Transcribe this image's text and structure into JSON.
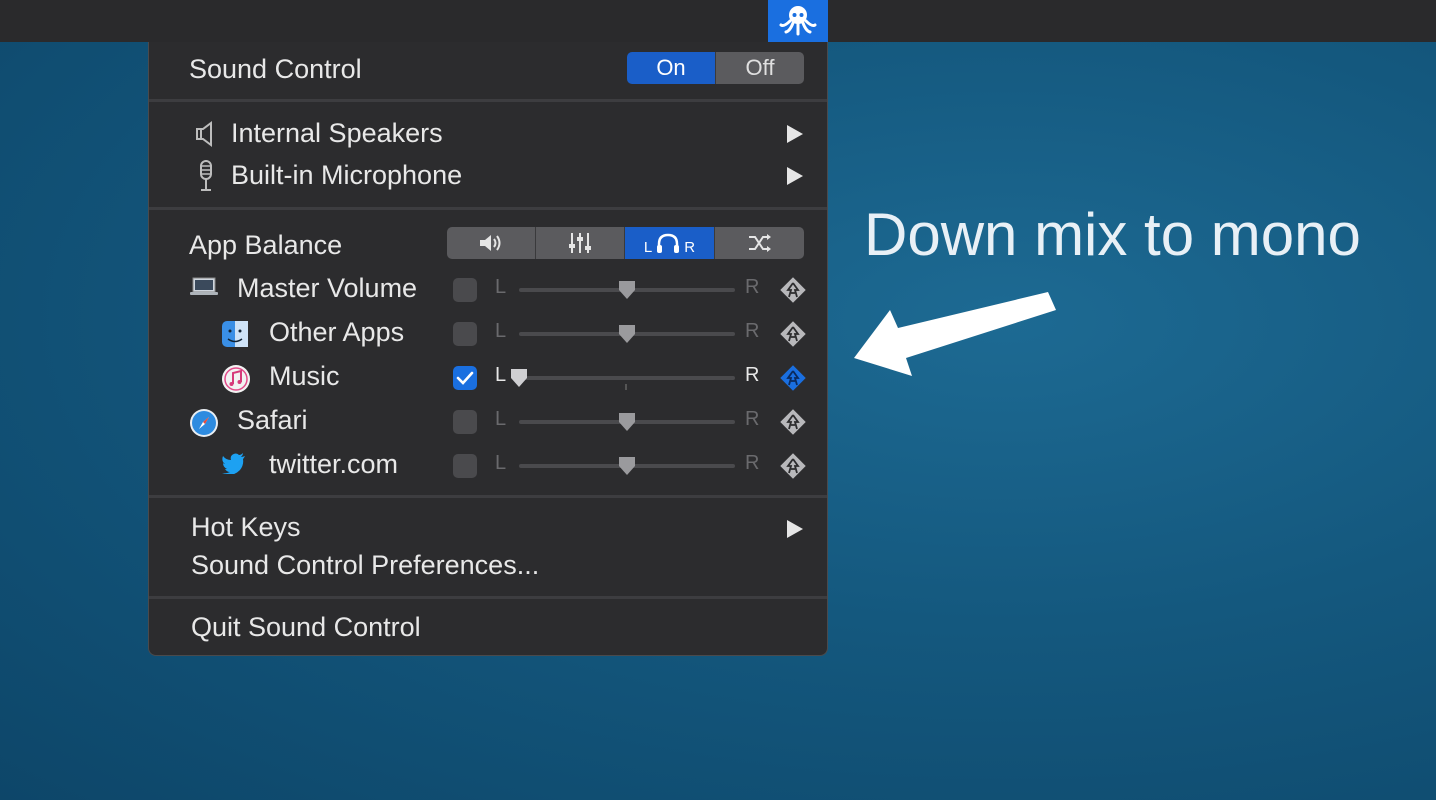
{
  "menubar": {
    "tray_icon": "octopus-icon"
  },
  "menu": {
    "title": "Sound Control",
    "power_toggle": {
      "on_label": "On",
      "off_label": "Off",
      "selected": "On"
    },
    "devices": [
      {
        "label": "Internal Speakers",
        "icon": "speaker-icon"
      },
      {
        "label": "Built-in Microphone",
        "icon": "microphone-icon"
      }
    ],
    "app_balance": {
      "label": "App Balance",
      "modes": [
        {
          "name": "volume",
          "icon": "volume-icon"
        },
        {
          "name": "equalizer",
          "icon": "equalizer-icon"
        },
        {
          "name": "balance",
          "icon": "headphones-icon",
          "l": "L",
          "r": "R",
          "active": true
        },
        {
          "name": "shuffle",
          "icon": "shuffle-icon"
        }
      ],
      "rows": [
        {
          "name": "Master Volume",
          "icon": "laptop-icon",
          "checked": false,
          "balance": 0.5
        },
        {
          "name": "Other Apps",
          "icon": "finder-icon",
          "checked": false,
          "balance": 0.5
        },
        {
          "name": "Music",
          "icon": "music-icon",
          "checked": true,
          "balance": 0.0
        },
        {
          "name": "Safari",
          "icon": "safari-icon",
          "checked": false,
          "balance": 0.5
        },
        {
          "name": "twitter.com",
          "icon": "twitter-icon",
          "checked": false,
          "balance": 0.5
        }
      ],
      "left_label": "L",
      "right_label": "R"
    },
    "hot_keys": "Hot Keys",
    "preferences": "Sound Control Preferences...",
    "quit": "Quit Sound Control"
  },
  "annotation": "Down mix to mono",
  "colors": {
    "accent": "#1a6fe0",
    "menu_bg": "#2c2c2e",
    "desktop": "#14587e"
  }
}
